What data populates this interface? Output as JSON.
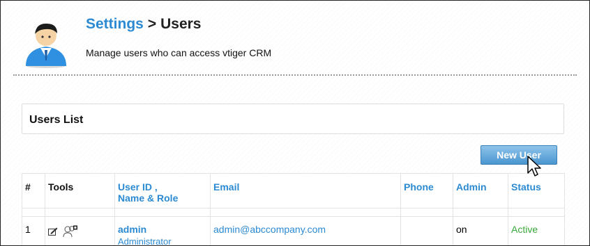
{
  "header": {
    "breadcrumb_link": "Settings",
    "breadcrumb_sep": ">",
    "breadcrumb_current": "Users",
    "subtitle": "Manage users who can access vtiger CRM"
  },
  "section": {
    "title": "Users List"
  },
  "actions": {
    "new_user_label": "New User"
  },
  "table": {
    "headers": {
      "num": "#",
      "tools": "Tools",
      "user_id_line1": "User ID ,",
      "user_id_line2": "Name & Role",
      "email": "Email",
      "phone": "Phone",
      "admin": "Admin",
      "status": "Status"
    },
    "rows": [
      {
        "num": "1",
        "user_id": "admin",
        "role": "Administrator",
        "email": "admin@abccompany.com",
        "phone": "",
        "admin": "on",
        "status": "Active"
      }
    ]
  },
  "colors": {
    "link": "#2c8ad3",
    "status_active": "#39a83a",
    "button_top": "#8ec4ea",
    "button_bottom": "#4a95d0"
  },
  "icons": {
    "header": "user-admin-avatar-icon",
    "edit": "edit-icon",
    "duplicate": "duplicate-user-icon",
    "cursor": "mouse-pointer-icon"
  }
}
